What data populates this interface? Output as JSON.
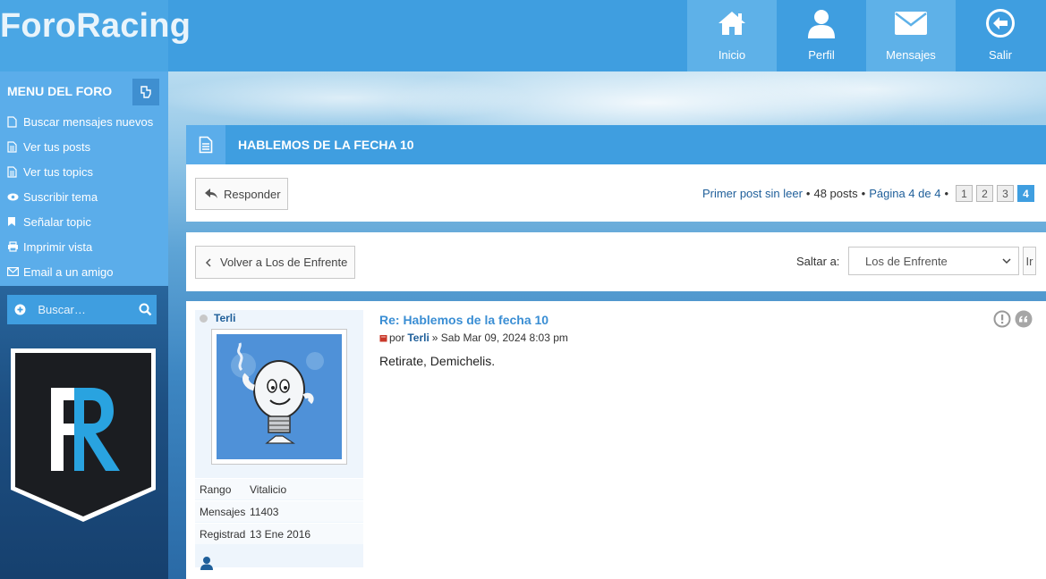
{
  "header": {
    "brand": "ForoRacing",
    "nav": [
      {
        "label": "Inicio",
        "icon": "home-icon"
      },
      {
        "label": "Perfil",
        "icon": "user-icon"
      },
      {
        "label": "Mensajes",
        "icon": "envelope-icon"
      },
      {
        "label": "Salir",
        "icon": "logout-icon"
      }
    ]
  },
  "sidebar": {
    "title": "MENU DEL FORO",
    "items": [
      {
        "label": "Buscar mensajes nuevos",
        "icon": "file-icon"
      },
      {
        "label": "Ver tus posts",
        "icon": "file-text-icon"
      },
      {
        "label": "Ver tus topics",
        "icon": "file-text-icon"
      },
      {
        "label": "Suscribir tema",
        "icon": "eye-icon"
      },
      {
        "label": "Señalar topic",
        "icon": "bookmark-icon"
      },
      {
        "label": "Imprimir vista",
        "icon": "print-icon"
      },
      {
        "label": "Email a un amigo",
        "icon": "envelope-icon"
      }
    ],
    "search_placeholder": "Buscar…"
  },
  "topic": {
    "title": "HABLEMOS DE LA FECHA 10"
  },
  "actions": {
    "reply_label": "Responder",
    "first_unread": "Primer post sin leer",
    "posts_count": "48 posts",
    "page_info": "Página 4 de 4",
    "pages": [
      "1",
      "2",
      "3",
      "4"
    ],
    "current_page": "4"
  },
  "navigation": {
    "back_label": "Volver a Los de Enfrente",
    "jump_label": "Saltar a:",
    "jump_value": "Los de Enfrente",
    "go_label": "Ir"
  },
  "post": {
    "author": "Terli",
    "profile": [
      {
        "key": "Rango",
        "value": "Vitalicio"
      },
      {
        "key": "Mensajes:",
        "value": "11403"
      },
      {
        "key": "Registrado:",
        "value": "13 Ene 2016"
      }
    ],
    "title": "Re: Hablemos de la fecha 10",
    "by": "por",
    "date": "» Sab Mar 09, 2024 8:03 pm",
    "body": "Retirate, Demichelis."
  },
  "colors": {
    "primary": "#3f9ee0",
    "sidebar": "#5badea",
    "link": "#1f5f9a",
    "post_title": "#3a8ed4"
  }
}
